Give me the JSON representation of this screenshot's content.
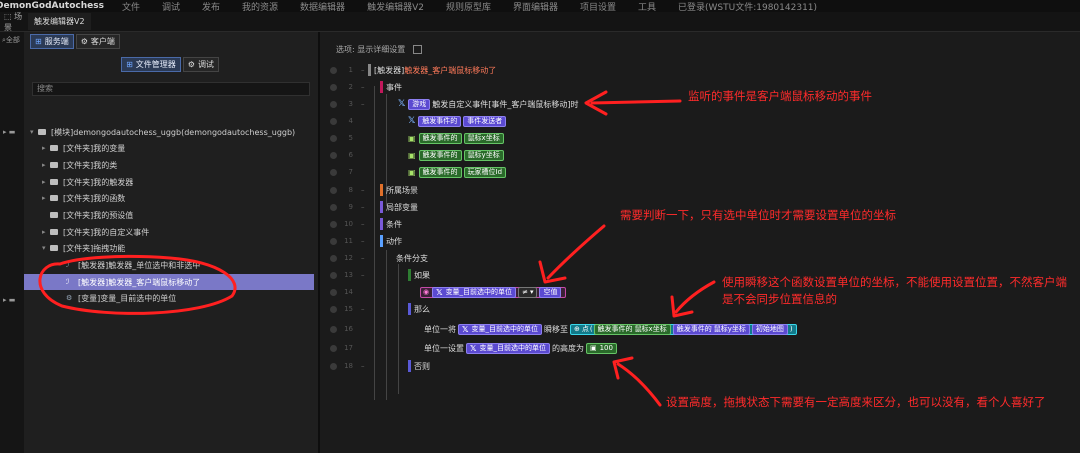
{
  "topbar": {
    "app": "DemonGodAutochess",
    "menu": [
      "文件",
      "调试",
      "发布",
      "我的资源",
      "数据编辑器",
      "触发编辑器V2",
      "规则原型库",
      "界面编辑器",
      "项目设置",
      "工具",
      "已登录(WSTU文件:1980142311)"
    ]
  },
  "tabs": {
    "scene": "场景",
    "editor": "触发编辑器V2"
  },
  "gutter": {
    "all": "全部"
  },
  "left": {
    "server_tab": "服务端",
    "client_tab": "客户端",
    "file_mgr": "文件管理器",
    "debug": "调试",
    "search_placeholder": "搜索",
    "tree": {
      "root": "[模块]demongodautochess_uggb(demongodautochess_uggb)",
      "items": [
        "[文件夹]我的变量",
        "[文件夹]我的类",
        "[文件夹]我的触发器",
        "[文件夹]我的函数",
        "[文件夹]我的预设值",
        "[文件夹]我的自定义事件",
        "[文件夹]拖拽功能",
        "[触发器]触发器_单位选中和非选中",
        "[触发器]触发器_客户端鼠标移动了",
        "[变量]变量_目前选中的单位"
      ]
    }
  },
  "main": {
    "option_label": "选项: 显示详细设置",
    "line_numbers": [
      "1",
      "2",
      "3",
      "4",
      "5",
      "6",
      "7",
      "8",
      "9",
      "10",
      "11",
      "12",
      "13",
      "14",
      "15",
      "16",
      "17",
      "18"
    ],
    "trigger_label": "[触发器]",
    "trigger_name": "触发器_客户端鼠标移动了",
    "event_label": "事件",
    "event_game": "游戏",
    "event_custom": "触发自定义事件[事件_客户端鼠标移动]时",
    "event_param_prefix": "触发事件的",
    "event_params": [
      "事件发送者",
      "鼠标x坐标",
      "鼠标y坐标",
      "玩家槽位Id"
    ],
    "scene_label": "所属场景",
    "local_var_label": "局部变量",
    "cond_label": "条件",
    "action_label": "动作",
    "branch_label": "条件分支",
    "if_label": "如果",
    "if_var": "变量_目前选中的单位",
    "if_op": "≠",
    "if_null": "空值",
    "then_label": "那么",
    "move_prefix": "单位一将",
    "move_var": "变量_目前选中的单位",
    "move_mid": "瞬移至",
    "point_label": "点",
    "point_x_prefix": "触发事件的",
    "point_x": "鼠标x坐标",
    "point_y_prefix": "触发事件的",
    "point_y": "鼠标y坐标",
    "point_map": "初始地图",
    "height_prefix": "单位一设置",
    "height_var": "变量_目前选中的单位",
    "height_mid": "的高度为",
    "height_val": "100",
    "else_label": "否则"
  },
  "annotations": {
    "a1": "监听的事件是客户端鼠标移动的事件",
    "a2": "需要判断一下，只有选中单位时才需要设置单位的坐标",
    "a3": "使用瞬移这个函数设置单位的坐标，不能使用设置位置，不然客户端是不会同步位置信息的",
    "a4": "设置高度，拖拽状态下需要有一定高度来区分，也可以没有，看个人喜好了"
  },
  "colors": {
    "accent": "#5b4ad1",
    "annotation": "#ff2b2b",
    "selected": "#7a78c7"
  }
}
